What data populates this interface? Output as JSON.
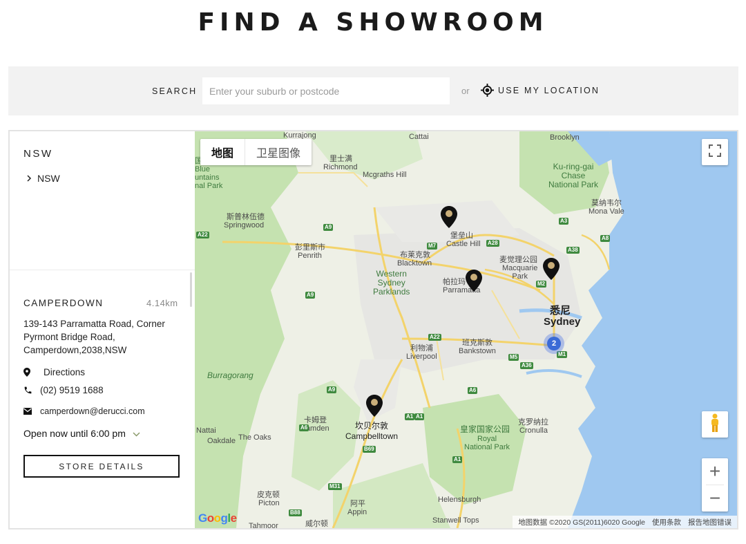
{
  "page": {
    "title": "FIND A SHOWROOM"
  },
  "search": {
    "label": "SEARCH",
    "placeholder": "Enter your suburb or postcode",
    "value": "",
    "or_text": "or",
    "use_location_label": "USE MY LOCATION"
  },
  "sidebar": {
    "region_title": "NSW",
    "region_items": [
      {
        "label": "NSW"
      }
    ]
  },
  "store": {
    "name": "CAMPERDOWN",
    "distance": "4.14km",
    "address": "139-143 Parramatta Road, Corner Pyrmont Bridge Road, Camperdown,2038,NSW",
    "directions_label": "Directions",
    "phone": "(02) 9519 1688",
    "email": "camperdown@derucci.com",
    "hours": "Open now until 6:00 pm",
    "details_button": "STORE DETAILS"
  },
  "map": {
    "type_tabs": [
      "地图",
      "卫星图像"
    ],
    "active_tab": "地图",
    "cluster_count": "2",
    "zoom_in": "+",
    "zoom_out": "−",
    "google_logo": "Google",
    "attribution": [
      "地图数据 ©2020 GS(2011)6020 Google",
      "使用条款",
      "报告地图错误"
    ],
    "labels": {
      "kurrajong": "Kurrajong",
      "cattai": "Cattai",
      "brooklyn": "Brooklyn",
      "richmond_cn": "里士满",
      "richmond": "Richmond",
      "mcgraths_hill": "Mcgraths Hill",
      "kuringgai": "Ku-ring-gai\nChase\nNational Park",
      "blue_mountains": "国\nBlue\nuntains\nnal Park",
      "mona_vale_cn": "莫纳韦尔",
      "mona_vale": "Mona Vale",
      "springwood_cn": "斯普林伍德",
      "springwood": "Springwood",
      "castle_hill_cn": "堡垒山",
      "castle_hill": "Castle Hill",
      "penrith_cn": "彭里斯市",
      "penrith": "Penrith",
      "blacktown_cn": "布莱克敦",
      "blacktown": "Blacktown",
      "macquarie_park_cn": "麦觉理公园",
      "macquarie_park": "Macquarie\nPark",
      "western_sydney_parklands": "Western\nSydney\nParklands",
      "parramatta_cn": "帕拉玛",
      "parramatta": "Parramatta",
      "sydney_cn": "悉尼",
      "sydney": "Sydney",
      "liverpool_cn": "利物浦",
      "liverpool": "Liverpool",
      "bankstown_cn": "班克斯敦",
      "bankstown": "Bankstown",
      "burragorang": "Burragorang",
      "camden_cn": "卡姆登",
      "camden": "Camden",
      "campbelltown_cn": "坎贝尔敦",
      "campbelltown": "Campbelltown",
      "the_oaks": "The Oaks",
      "nattai": "Nattai",
      "oakdale": "Oakdale",
      "royal_np_cn": "皇家国家公园",
      "royal_np": "Royal\nNational Park",
      "cronulla_cn": "克罗纳拉",
      "cronulla": "Cronulla",
      "picton_cn": "皮克顿",
      "picton": "Picton",
      "appin_cn": "阿平",
      "appin": "Appin",
      "helensburgh": "Helensburgh",
      "stanwell_tops": "Stanwell Tops",
      "tahmoor": "Tahmoor",
      "wilton_cn": "威尔顿"
    },
    "shields": [
      "A9",
      "A9",
      "M7",
      "A28",
      "A3",
      "A38",
      "A8",
      "M2",
      "A22",
      "A6",
      "M5",
      "A36",
      "M1",
      "A9",
      "A6",
      "A1",
      "B69",
      "A1",
      "M31",
      "B88",
      "A22",
      "A1"
    ]
  },
  "colors": {
    "pin": "#111111",
    "pin_dot": "#c9ae7a",
    "cluster": "#3b6bd6",
    "water": "#9fc8f0",
    "park": "#c5e2b0",
    "urban": "#e8e8e8"
  }
}
